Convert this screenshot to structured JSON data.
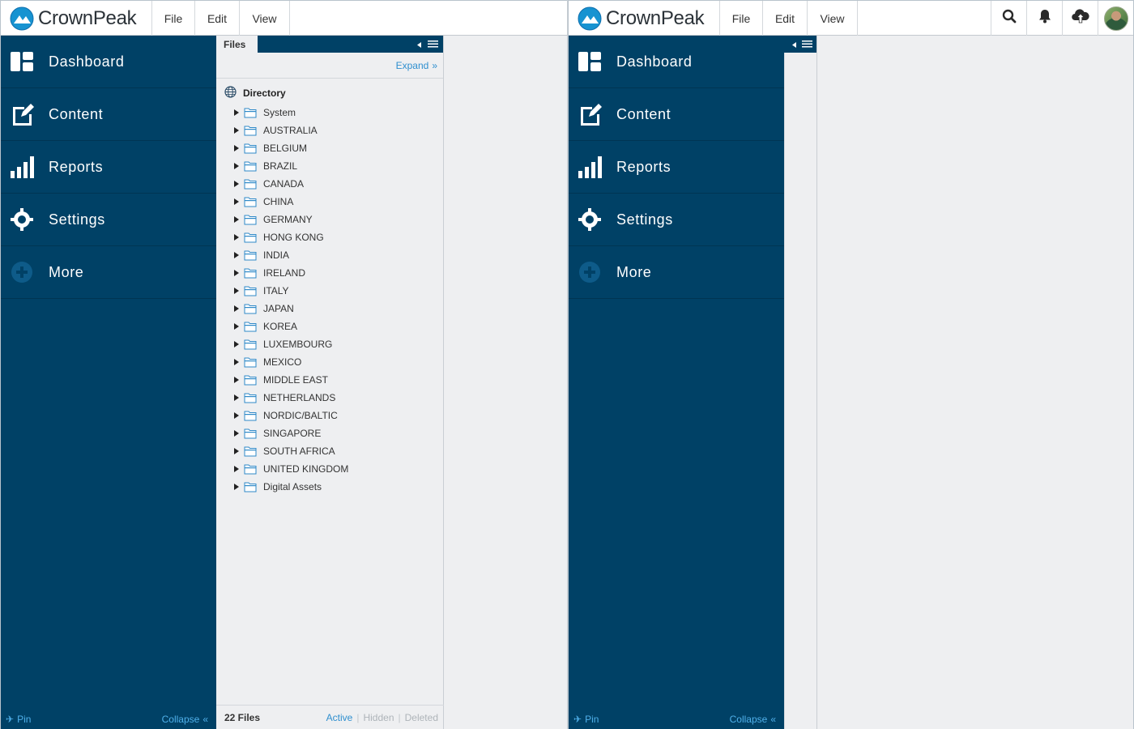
{
  "brand": {
    "name": "CrownPeak"
  },
  "menu": {
    "file": "File",
    "edit": "Edit",
    "view": "View"
  },
  "toolbar": {
    "search_icon": "search-icon",
    "notifications_icon": "bell-icon",
    "upload_icon": "cloud-upload-icon",
    "avatar_icon": "avatar"
  },
  "sidebar": {
    "items": [
      {
        "label": "Dashboard",
        "icon": "dashboard-icon"
      },
      {
        "label": "Content",
        "icon": "edit-icon"
      },
      {
        "label": "Reports",
        "icon": "bar-chart-icon"
      },
      {
        "label": "Settings",
        "icon": "gear-icon"
      },
      {
        "label": "More",
        "icon": "plus-circle-icon"
      }
    ],
    "pin": "Pin",
    "collapse": "Collapse"
  },
  "files_panel": {
    "tab": "Files",
    "expand": "Expand",
    "root": "Directory",
    "folders": [
      "System",
      "AUSTRALIA",
      "BELGIUM",
      "BRAZIL",
      "CANADA",
      "CHINA",
      "GERMANY",
      "HONG KONG",
      "INDIA",
      "IRELAND",
      "ITALY",
      "JAPAN",
      "KOREA",
      "LUXEMBOURG",
      "MEXICO",
      "MIDDLE EAST",
      "NETHERLANDS",
      "NORDIC/BALTIC",
      "SINGAPORE",
      "SOUTH AFRICA",
      "UNITED KINGDOM",
      "Digital Assets"
    ],
    "file_count": "22 Files",
    "filters": {
      "active": "Active",
      "hidden": "Hidden",
      "deleted": "Deleted"
    }
  },
  "colors": {
    "sidebar": "#004166",
    "accent": "#2f8fcf",
    "link": "#4fb0ea",
    "background": "#eeeff1"
  }
}
